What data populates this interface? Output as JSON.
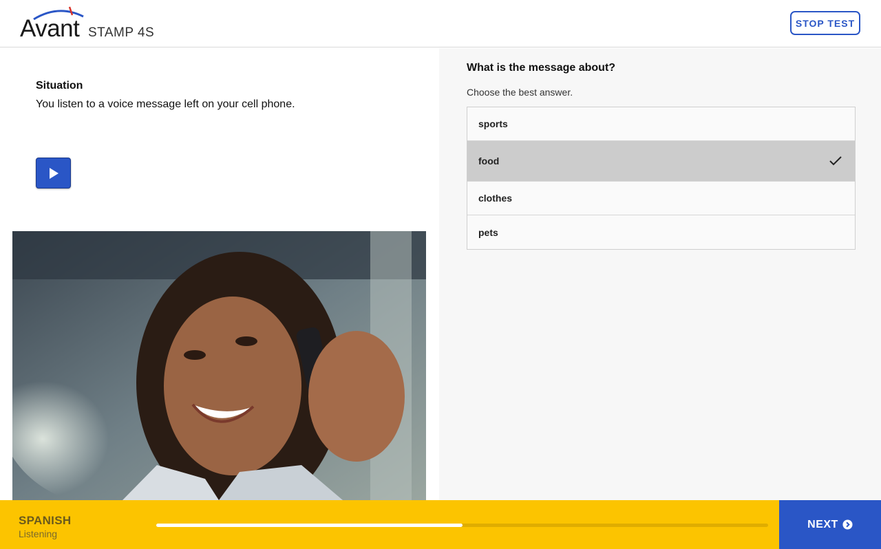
{
  "header": {
    "logo_word": "Avant",
    "logo_sub": "STAMP 4S",
    "stop_label": "STOP TEST"
  },
  "prompt": {
    "situation_title": "Situation",
    "situation_text": "You listen to a voice message left on your cell phone.",
    "play_icon": "play-icon",
    "image_subject": "woman-on-phone-photo"
  },
  "question": {
    "title": "What is the message about?",
    "instruction": "Choose the best answer.",
    "options": [
      {
        "label": "sports",
        "selected": false
      },
      {
        "label": "food",
        "selected": true
      },
      {
        "label": "clothes",
        "selected": false
      },
      {
        "label": "pets",
        "selected": false
      }
    ]
  },
  "footer": {
    "language": "SPANISH",
    "skill": "Listening",
    "progress": 0.5,
    "next_label": "NEXT",
    "next_icon": "chevron-right-circle-icon"
  },
  "colors": {
    "accent_blue": "#2a56c6",
    "footer_yellow": "#fcc400",
    "selected_gray": "#cccccc"
  }
}
